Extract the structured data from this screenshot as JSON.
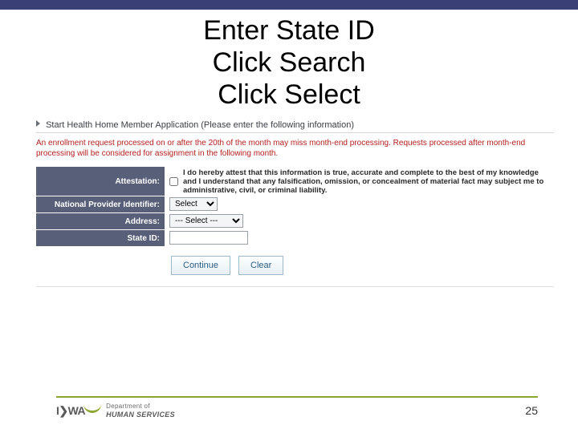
{
  "title_lines": [
    "Enter State ID",
    "Click Search",
    "Click Select"
  ],
  "form": {
    "header": "Start Health Home Member Application (Please enter the following information)",
    "note": "An enrollment request processed on or after the 20th of the month may miss month-end processing. Requests processed after month-end processing will be considered for assignment in the following month.",
    "attestation_label": "Attestation:",
    "attestation_text": "I do hereby attest that this information is true, accurate and complete to the best of my knowledge and I understand that any falsification, omission, or concealment of material fact may subject me to administrative, civil, or criminal liability.",
    "npi_label": "National Provider Identifier:",
    "npi_value": "Select",
    "address_label": "Address:",
    "address_value": "--- Select ---",
    "stateid_label": "State ID:",
    "stateid_value": "",
    "continue_label": "Continue",
    "clear_label": "Clear"
  },
  "footer": {
    "mark": "I❯WA",
    "dept_line1": "Department of",
    "dept_line2": "HUMAN SERVICES",
    "page": "25"
  }
}
